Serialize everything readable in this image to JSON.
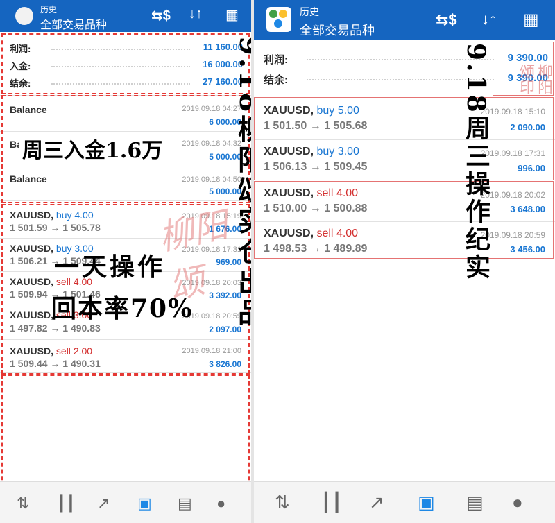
{
  "left": {
    "header": {
      "title_small": "历史",
      "title_main": "全部交易品种"
    },
    "summary": [
      {
        "label": "利润:",
        "value": "11 160.00"
      },
      {
        "label": "入金:",
        "value": "16 000.00"
      },
      {
        "label": "结余:",
        "value": "27 160.00"
      }
    ],
    "balance_rows": [
      {
        "label": "Balance",
        "time": "2019.09.18 04:27",
        "amount": "6 000.00"
      },
      {
        "label": "Balance",
        "time": "2019.09.18 04:32",
        "amount": "5 000.00"
      },
      {
        "label": "Balance",
        "time": "2019.09.18 04:50",
        "amount": "5 000.00"
      }
    ],
    "trades": [
      {
        "symbol": "XAUUSD,",
        "side": "buy",
        "lots": "4.00",
        "prices": "1 501.59 → 1 505.78",
        "time": "2019.09.18 15:19",
        "profit": "1 676.00"
      },
      {
        "symbol": "XAUUSD,",
        "side": "buy",
        "lots": "3.00",
        "prices": "1 506.21 → 1 509.44",
        "time": "2019.09.18 17:31",
        "profit": "969.00"
      },
      {
        "symbol": "XAUUSD,",
        "side": "sell",
        "lots": "4.00",
        "prices": "1 509.94 → 1 501.46",
        "time": "2019.09.18 20:03",
        "profit": "3 392.00"
      },
      {
        "symbol": "XAUUSD,",
        "side": "sell",
        "lots": "3.00",
        "prices": "1 497.82 → 1 490.83",
        "time": "2019.09.18 20:59",
        "profit": "2 097.00"
      },
      {
        "symbol": "XAUUSD,",
        "side": "sell",
        "lots": "2.00",
        "prices": "1 509.44 → 1 490.31",
        "time": "2019.09.18 21:00",
        "profit": "3 826.00"
      }
    ],
    "overlay": {
      "deposit_note": "周三入金1.6万",
      "day_note_1": "一天操作",
      "day_note_2": "回本率70%",
      "vertical_note": "9.18柳阳颂实仓出品"
    }
  },
  "right": {
    "header": {
      "title_small": "历史",
      "title_main": "全部交易品种"
    },
    "summary": [
      {
        "label": "利润:",
        "value": "9 390.00"
      },
      {
        "label": "结余:",
        "value": "9 390.00"
      }
    ],
    "trades": [
      {
        "symbol": "XAUUSD,",
        "side": "buy",
        "lots": "5.00",
        "prices": "1 501.50 → 1 505.68",
        "time": "2019.09.18 15:10",
        "profit": "2 090.00"
      },
      {
        "symbol": "XAUUSD,",
        "side": "buy",
        "lots": "3.00",
        "prices": "1 506.13 → 1 509.45",
        "time": "2019.09.18 17:31",
        "profit": "996.00"
      },
      {
        "symbol": "XAUUSD,",
        "side": "sell",
        "lots": "4.00",
        "prices": "1 510.00 → 1 500.88",
        "time": "2019.09.18 20:02",
        "profit": "3 648.00"
      },
      {
        "symbol": "XAUUSD,",
        "side": "sell",
        "lots": "4.00",
        "prices": "1 498.53 → 1 489.89",
        "time": "2019.09.18 20:59",
        "profit": "3 456.00"
      }
    ],
    "overlay": {
      "vertical_note": "9.18周三操作纪实",
      "stamp_text": "柳阳颂印"
    }
  },
  "icons": {
    "top": [
      "currency-swap-icon",
      "sort-icon",
      "calendar-icon"
    ],
    "bottom": [
      "quotes-icon",
      "chart-icon",
      "trade-icon",
      "history-icon",
      "news-icon",
      "chat-icon"
    ]
  },
  "colors": {
    "header_blue": "#1565c0",
    "buy_blue": "#1976d2",
    "sell_red": "#d32f2f",
    "dash_red": "#e53935"
  }
}
